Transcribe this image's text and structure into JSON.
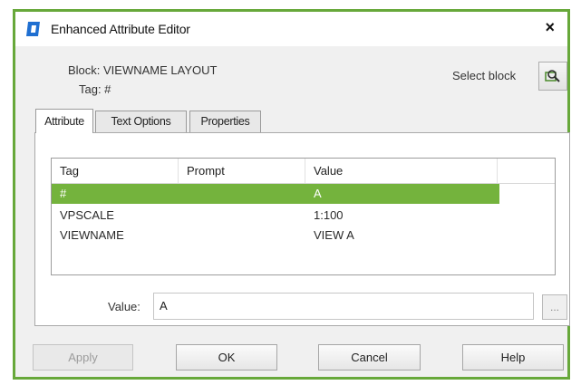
{
  "window": {
    "title": "Enhanced Attribute Editor",
    "close_label": "×"
  },
  "block_info": {
    "block": "Block: VIEWNAME LAYOUT",
    "tag": "Tag: #"
  },
  "select_block": {
    "label": "Select block"
  },
  "tabs": [
    {
      "label": "Attribute",
      "active": true
    },
    {
      "label": "Text Options",
      "active": false
    },
    {
      "label": "Properties",
      "active": false
    }
  ],
  "attribute_table": {
    "columns": [
      "Tag",
      "Prompt",
      "Value"
    ],
    "rows": [
      {
        "tag": "#",
        "prompt": "",
        "value": "A",
        "selected": true
      },
      {
        "tag": "VPSCALE",
        "prompt": "",
        "value": "1:100",
        "selected": false
      },
      {
        "tag": "VIEWNAME",
        "prompt": "",
        "value": "VIEW A",
        "selected": false
      }
    ]
  },
  "value_field": {
    "label": "Value:",
    "value": "A",
    "more_label": "..."
  },
  "buttons": {
    "apply": "Apply",
    "ok": "OK",
    "cancel": "Cancel",
    "help": "Help"
  },
  "colors": {
    "accent": "#74b33d",
    "frame": "#67a83a",
    "dialog_bg": "#f0f0f0"
  }
}
